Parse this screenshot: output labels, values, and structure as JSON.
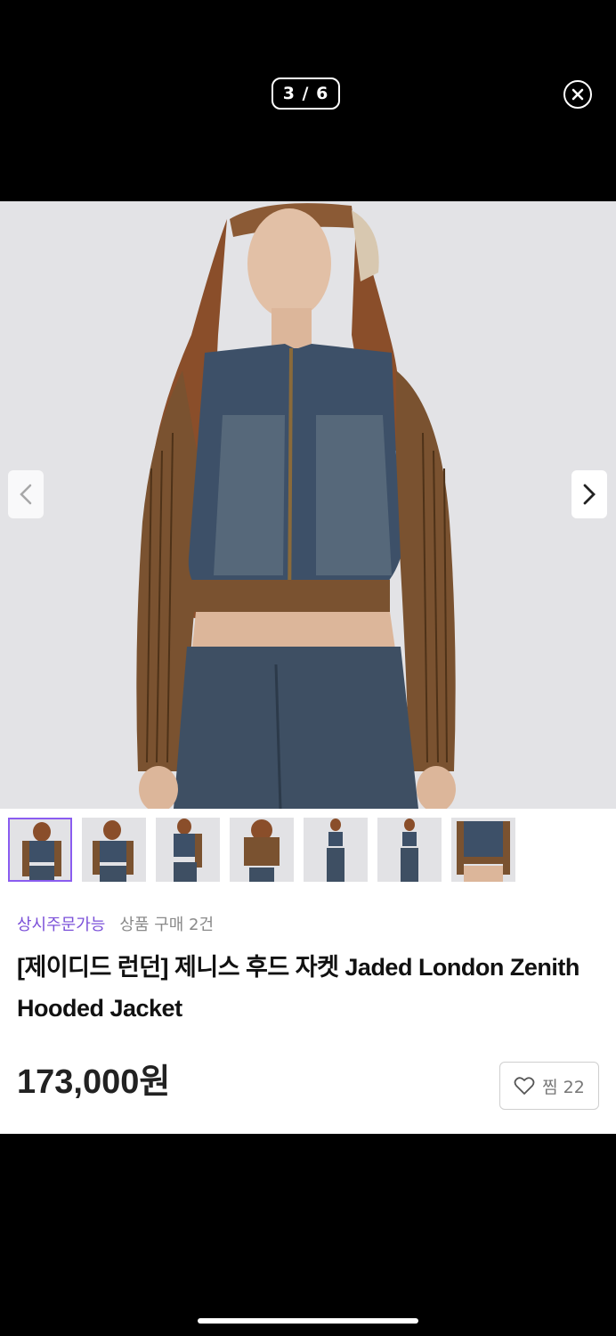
{
  "viewer": {
    "counter": "3 / 6",
    "close_icon": "close-circle-icon",
    "prev_icon": "chevron-left-icon",
    "next_icon": "chevron-right-icon"
  },
  "thumbnails": [
    {
      "label": "thumbnail-1",
      "active": true
    },
    {
      "label": "thumbnail-2",
      "active": false
    },
    {
      "label": "thumbnail-3",
      "active": false
    },
    {
      "label": "thumbnail-4",
      "active": false
    },
    {
      "label": "thumbnail-5",
      "active": false
    },
    {
      "label": "thumbnail-6",
      "active": false
    },
    {
      "label": "thumbnail-7",
      "active": false
    }
  ],
  "product": {
    "availability": "상시주문가능",
    "purchase_count": "상품 구매 2건",
    "title": "[제이디드 런던] 제니스 후드 자켓 Jaded London Zenith Hooded Jacket",
    "price": "173,000원",
    "wish_label": "찜 22"
  },
  "colors": {
    "accent": "#7a4fd8",
    "background_dark": "#000000",
    "denim": "#3d5068",
    "rib_brown": "#7a5230"
  }
}
